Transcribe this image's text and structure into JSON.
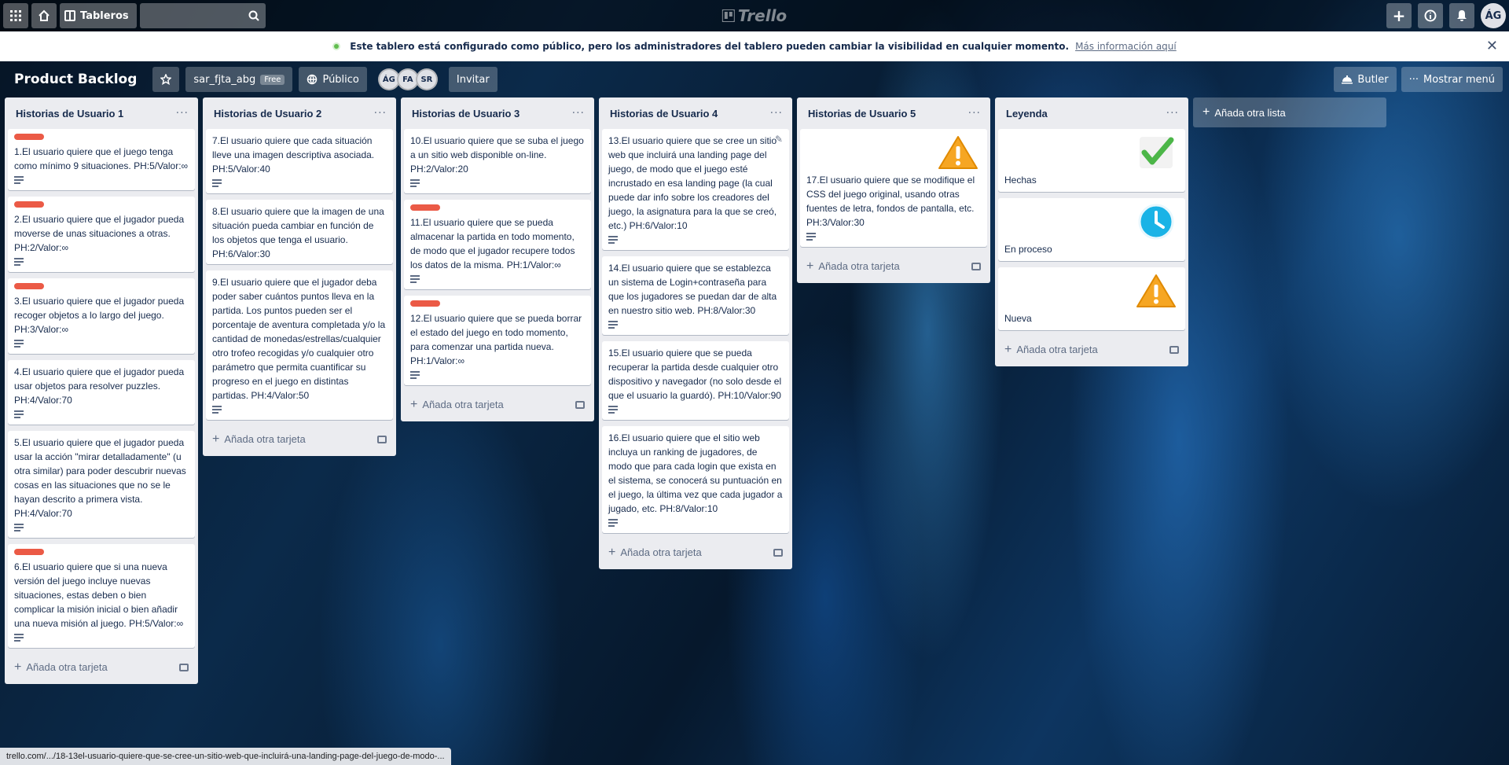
{
  "topbar": {
    "boards_label": "Tableros",
    "logo_text": "Trello",
    "avatar_initials": "ÁG"
  },
  "notice": {
    "text": "Este tablero está configurado como público, pero los administradores del tablero pueden cambiar la visibilidad en cualquier momento.",
    "link": "Más información aquí"
  },
  "board": {
    "title": "Product Backlog",
    "team": "sar_fjta_abg",
    "team_badge": "Free",
    "visibility": "Público",
    "members": [
      "ÁG",
      "FA",
      "SR"
    ],
    "invite": "Invitar",
    "butler": "Butler",
    "menu": "Mostrar menú",
    "add_list": "Añada otra lista",
    "add_card": "Añada otra tarjeta"
  },
  "lists": [
    {
      "title": "Historias de Usuario 1",
      "cards": [
        {
          "label": "red",
          "text": "1.El usuario quiere que el juego tenga como mínimo 9 situaciones. PH:5/Valor:∞"
        },
        {
          "label": "red",
          "text": "2.El usuario quiere que el jugador pueda moverse de unas situaciones a otras. PH:2/Valor:∞"
        },
        {
          "label": "red",
          "text": "3.El usuario quiere que el jugador pueda recoger objetos a lo largo del juego. PH:3/Valor:∞"
        },
        {
          "label": "",
          "text": "4.El usuario quiere que el jugador pueda usar objetos para resolver puzzles. PH:4/Valor:70"
        },
        {
          "label": "",
          "text": "5.El usuario quiere que el jugador pueda usar la acción \"mirar detalladamente\" (u otra similar) para poder descubrir nuevas cosas en las situaciones que no se le hayan descrito a primera vista. PH:4/Valor:70"
        },
        {
          "label": "red",
          "text": "6.El usuario quiere que si una nueva versión del juego incluye nuevas situaciones, estas deben o bien complicar la misión inicial o bien añadir una nueva misión al juego. PH:5/Valor:∞"
        }
      ]
    },
    {
      "title": "Historias de Usuario 2",
      "cards": [
        {
          "label": "",
          "text": "7.El usuario quiere que cada situación lleve una imagen descriptiva asociada. PH:5/Valor:40"
        },
        {
          "label": "",
          "text": "8.El usuario quiere que la imagen de una situación pueda cambiar en función de los objetos que tenga el usuario. PH:6/Valor:30"
        },
        {
          "label": "",
          "text": "9.El usuario quiere que el jugador deba poder saber cuántos puntos lleva en la partida. Los puntos pueden ser el porcentaje de aventura completada y/o la cantidad de monedas/estrellas/cualquier otro trofeo recogidas y/o cualquier otro parámetro que permita cuantificar su progreso en el juego en distintas partidas. PH:4/Valor:50"
        }
      ]
    },
    {
      "title": "Historias de Usuario 3",
      "cards": [
        {
          "label": "",
          "text": "10.El usuario quiere que se suba el juego a un sitio web disponible on-line. PH:2/Valor:20"
        },
        {
          "label": "red",
          "text": "11.El usuario quiere que se pueda almacenar la partida en todo momento, de modo que el jugador recupere todos los datos de la misma. PH:1/Valor:∞"
        },
        {
          "label": "red",
          "text": "12.El usuario quiere que se pueda borrar el estado del juego en todo momento, para comenzar una partida nueva. PH:1/Valor:∞"
        }
      ]
    },
    {
      "title": "Historias de Usuario 4",
      "cards": [
        {
          "label": "",
          "text": "13.El usuario quiere que se cree un sitio web que incluirá una landing page del juego, de modo que el juego esté incrustado en esa landing page (la cual puede dar info sobre los creadores del juego, la asignatura para la que se creó, etc.) PH:6/Valor:10"
        },
        {
          "label": "",
          "text": "14.El usuario quiere que se establezca un sistema de Login+contraseña para que los jugadores se puedan dar de alta en nuestro sitio web. PH:8/Valor:30"
        },
        {
          "label": "",
          "text": "15.El usuario quiere que se pueda recuperar la partida desde cualquier otro dispositivo y navegador (no solo desde el que el usuario la guardó). PH:10/Valor:90"
        },
        {
          "label": "",
          "text": "16.El usuario quiere que el sitio web incluya un ranking de jugadores, de modo que para cada login que exista en el sistema, se conocerá su puntuación en el juego, la última vez que cada jugador a jugado, etc. PH:8/Valor:10"
        }
      ]
    },
    {
      "title": "Historias de Usuario 5",
      "cards": [
        {
          "label": "",
          "icon": "warning-icon",
          "text": "17.El usuario quiere que se modifique el CSS del juego original, usando otras fuentes de letra, fondos de pantalla, etc. PH:3/Valor:30"
        }
      ]
    },
    {
      "title": "Leyenda",
      "cards": [
        {
          "icon": "checkmark-icon",
          "text": "Hechas"
        },
        {
          "icon": "clock-icon",
          "text": "En proceso"
        },
        {
          "icon": "warning-icon",
          "text": "Nueva"
        }
      ]
    }
  ],
  "status_url": "trello.com/.../18-13el-usuario-quiere-que-se-cree-un-sitio-web-que-incluirá-una-landing-page-del-juego-de-modo-...",
  "colors": {
    "label_red": "#eb5a46",
    "list_bg": "#ebecf0",
    "public_dot": "#61bd4f",
    "warning": "#f6a623",
    "check": "#4cb648",
    "clock": "#1ab3e6"
  }
}
